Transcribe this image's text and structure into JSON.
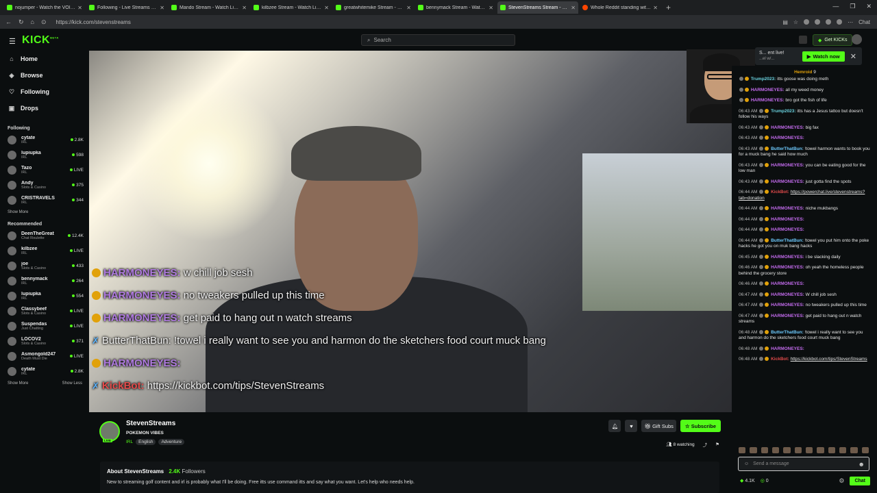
{
  "browser": {
    "tabs": [
      {
        "title": "nojumper - Watch the VOID on Kic",
        "active": false
      },
      {
        "title": "Following - Live Streams on Kick",
        "active": false
      },
      {
        "title": "Mando Stream - Watch Live on Kic",
        "active": false
      },
      {
        "title": "kilbzee Stream - Watch Live on Ki",
        "active": false
      },
      {
        "title": "greatwhitemike Stream - Watch Li",
        "active": false
      },
      {
        "title": "bennymack Stream - Watch Live o",
        "active": false
      },
      {
        "title": "StevenStreams Stream - Watc",
        "active": true
      },
      {
        "title": "Whole Reddit standing with Lush",
        "active": false
      }
    ],
    "url": "https://kick.com/stevenstreams",
    "chat_label": "Chat"
  },
  "topnav": {
    "logo": "KICK",
    "logo_beta": "BETA",
    "search_placeholder": "Search",
    "get_kicks": "Get KICKs"
  },
  "sidebar": {
    "nav": [
      {
        "label": "Home",
        "icon": "home-icon"
      },
      {
        "label": "Browse",
        "icon": "compass-icon"
      },
      {
        "label": "Following",
        "icon": "heart-icon"
      },
      {
        "label": "Drops",
        "icon": "gift-icon"
      }
    ],
    "following_title": "Following",
    "following": [
      {
        "name": "cytate",
        "category": "IRL",
        "viewers": "2.8K"
      },
      {
        "name": "lupiupka",
        "category": "IRL",
        "viewers": "598"
      },
      {
        "name": "Tazo",
        "category": "IRL",
        "viewers": "LIVE"
      },
      {
        "name": "Andy",
        "category": "Slots & Casino",
        "viewers": "375"
      },
      {
        "name": "CRISTRAVELS",
        "category": "IRL",
        "viewers": "344"
      }
    ],
    "show_more_1": "Show More",
    "recommended_title": "Recommended",
    "recommended": [
      {
        "name": "DeenTheGreat",
        "category": "Chat Roulette",
        "viewers": "12.4K"
      },
      {
        "name": "kilbzee",
        "category": "IRL",
        "viewers": "LIVE"
      },
      {
        "name": "joe",
        "category": "Slots & Casino",
        "viewers": "433"
      },
      {
        "name": "bennymack",
        "category": "IRL",
        "viewers": "264"
      },
      {
        "name": "lupiupka",
        "category": "IRL",
        "viewers": "554"
      },
      {
        "name": "Classybeef",
        "category": "Slots & Casino",
        "viewers": "LIVE"
      },
      {
        "name": "Suspendas",
        "category": "Just Chatting",
        "viewers": "LIVE"
      },
      {
        "name": "LOCOV2",
        "category": "Slots & Casino",
        "viewers": "371"
      },
      {
        "name": "Asmongold247",
        "category": "Death Must Die",
        "viewers": "LIVE"
      },
      {
        "name": "cytate",
        "category": "IRL",
        "viewers": "2.8K"
      }
    ],
    "show_more_2": "Show More",
    "show_less": "Show Less"
  },
  "overlay_chat": [
    {
      "user": "HARMONEYES:",
      "text": "w chill job sesh",
      "kind": "h"
    },
    {
      "user": "HARMONEYES:",
      "text": "no tweakers pulled up this time",
      "kind": "h"
    },
    {
      "user": "HARMONEYES:",
      "text": "get paid to hang out n watch streams",
      "kind": "h"
    },
    {
      "user": "ButterThatBun:",
      "text": "!towel i really want to see you and harmon do the sketchers food court muck bang",
      "kind": "b"
    },
    {
      "user": "HARMONEYES:",
      "text": "",
      "kind": "h"
    },
    {
      "user": "KickBot:",
      "text": "https://kickbot.com/tips/StevenStreams",
      "kind": "k"
    }
  ],
  "notification": {
    "title": "S... ent live!",
    "sub": "...el w/...",
    "watch_now": "Watch now"
  },
  "chat": {
    "pinned_user": "Hemroid",
    "pinned_count": "9",
    "messages": [
      {
        "ts": "",
        "user": "Trump2023:",
        "text": "itts goose was doing meth",
        "kind": "t"
      },
      {
        "ts": "",
        "user": "HARMONEYES:",
        "text": "all my weed money",
        "kind": "h"
      },
      {
        "ts": "",
        "user": "HARMONEYES:",
        "text": "bro got the fish of life",
        "kind": "h"
      },
      {
        "ts": "06:43 AM",
        "user": "Trump2023:",
        "text": "itts has a Jesus tattoo but doesn't follow his ways",
        "kind": "t"
      },
      {
        "ts": "06:43 AM",
        "user": "HARMONEYES:",
        "text": "big fax",
        "kind": "h"
      },
      {
        "ts": "06:43 AM",
        "user": "HARMONEYES:",
        "text": "",
        "kind": "h"
      },
      {
        "ts": "06:43 AM",
        "user": "ButterThatBun:",
        "text": "!towel harmon wants to book you for a muck bang he said how much",
        "kind": "b"
      },
      {
        "ts": "06:43 AM",
        "user": "HARMONEYES:",
        "text": "you can be eating good for the low man",
        "kind": "h"
      },
      {
        "ts": "06:43 AM",
        "user": "HARMONEYES:",
        "text": "just gotta find the spots",
        "kind": "h"
      },
      {
        "ts": "06:44 AM",
        "user": "KickBot:",
        "text": "https://powerchat.live/stevenstreams?tab=donation",
        "kind": "k"
      },
      {
        "ts": "06:44 AM",
        "user": "HARMONEYES:",
        "text": "niche mukbangs",
        "kind": "h"
      },
      {
        "ts": "06:44 AM",
        "user": "HARMONEYES:",
        "text": "",
        "kind": "h"
      },
      {
        "ts": "06:44 AM",
        "user": "HARMONEYES:",
        "text": "",
        "kind": "h"
      },
      {
        "ts": "06:44 AM",
        "user": "ButterThatBun:",
        "text": "!towel you put him onto the poke hacks he got you on muk bang hacks",
        "kind": "b"
      },
      {
        "ts": "06:45 AM",
        "user": "HARMONEYES:",
        "text": "i be slacking daily",
        "kind": "h"
      },
      {
        "ts": "06:46 AM",
        "user": "HARMONEYES:",
        "text": "oh yeah the homeless people behind the grocery store",
        "kind": "h"
      },
      {
        "ts": "06:46 AM",
        "user": "HARMONEYES:",
        "text": "",
        "kind": "h"
      },
      {
        "ts": "06:47 AM",
        "user": "HARMONEYES:",
        "text": "W chill job sesh",
        "kind": "h"
      },
      {
        "ts": "06:47 AM",
        "user": "HARMONEYES:",
        "text": "no tweakers pulled up this time",
        "kind": "h"
      },
      {
        "ts": "06:47 AM",
        "user": "HARMONEYES:",
        "text": "get paid to hang out n watch streams",
        "kind": "h"
      },
      {
        "ts": "06:48 AM",
        "user": "ButterThatBun:",
        "text": "!towel i really want to see you and harmon do the sketchers food court muck bang",
        "kind": "b"
      },
      {
        "ts": "06:48 AM",
        "user": "HARMONEYES:",
        "text": "",
        "kind": "h"
      },
      {
        "ts": "06:48 AM",
        "user": "KickBot:",
        "text": "https://kickbot.com/tips/StevenStreams",
        "kind": "k"
      }
    ],
    "input_placeholder": "Send a message",
    "kicks_count": "4.1K",
    "points_count": "0",
    "chat_button": "Chat"
  },
  "stream": {
    "name": "StevenStreams",
    "live_tag": "LIVE",
    "title": "POKEMON VIBES",
    "category": "IRL",
    "tags": [
      "English",
      "Adventure"
    ],
    "gift_subs": "Gift Subs",
    "subscribe": "Subscribe",
    "watching": "8 watching",
    "about_prefix": "About StevenStreams",
    "followers_count": "2.4K",
    "followers_label": "Followers",
    "description": "New to streaming golf content and irl is probably what I'll be doing. Free itts use command itts and say what you want. Let's help who needs help."
  },
  "colors": {
    "accent": "#53fc18",
    "background": "#0b0e0f",
    "harmon": "#c56cf0",
    "kickbot": "#e34b4b"
  }
}
